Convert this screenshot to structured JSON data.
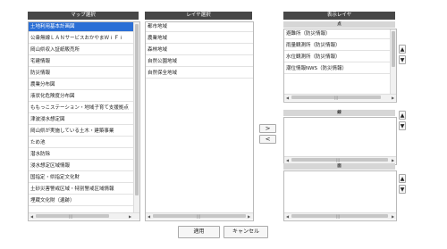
{
  "map_panel": {
    "title": "マップ選択",
    "items": [
      "土地利用基本計画図",
      "公衆無線ＬＡＮサービスおかやまＷｉＦｉ",
      "岡山県収入証紙販売所",
      "宅建情報",
      "防災情報",
      "農業分布図",
      "液状化危険度分布図",
      "ももっこステーション・地域子育て支援拠点",
      "津波浸水想定図",
      "岡山県が実施している土木・建築事業",
      "ため池",
      "潜水防除",
      "浸水想定区域情報",
      "国指定・県指定文化財",
      "土砂災害警戒区域・特別警戒区域情報",
      "埋蔵文化財（遺跡）"
    ],
    "selected_index": 0
  },
  "layer_panel": {
    "title": "レイヤ選択",
    "items": [
      "都市地域",
      "農業地域",
      "森林地域",
      "自然公園地域",
      "自然保全地域"
    ]
  },
  "display_panel": {
    "title": "表示レイヤ",
    "groups": [
      {
        "header": "点",
        "items": [
          "避難所（防災情報）",
          "雨量観測所（防災情報）",
          "水位観測所（防災情報）",
          "潮位情報NWS（防災情報）"
        ]
      },
      {
        "header": "線",
        "items": []
      },
      {
        "header": "面",
        "items": []
      }
    ]
  },
  "move_buttons": {
    "add": ">",
    "remove": "<"
  },
  "order_buttons": {
    "up": "▲",
    "down": "▼"
  },
  "scroll_grip": "|||",
  "actions": {
    "apply": "適用",
    "cancel": "キャンセル"
  }
}
